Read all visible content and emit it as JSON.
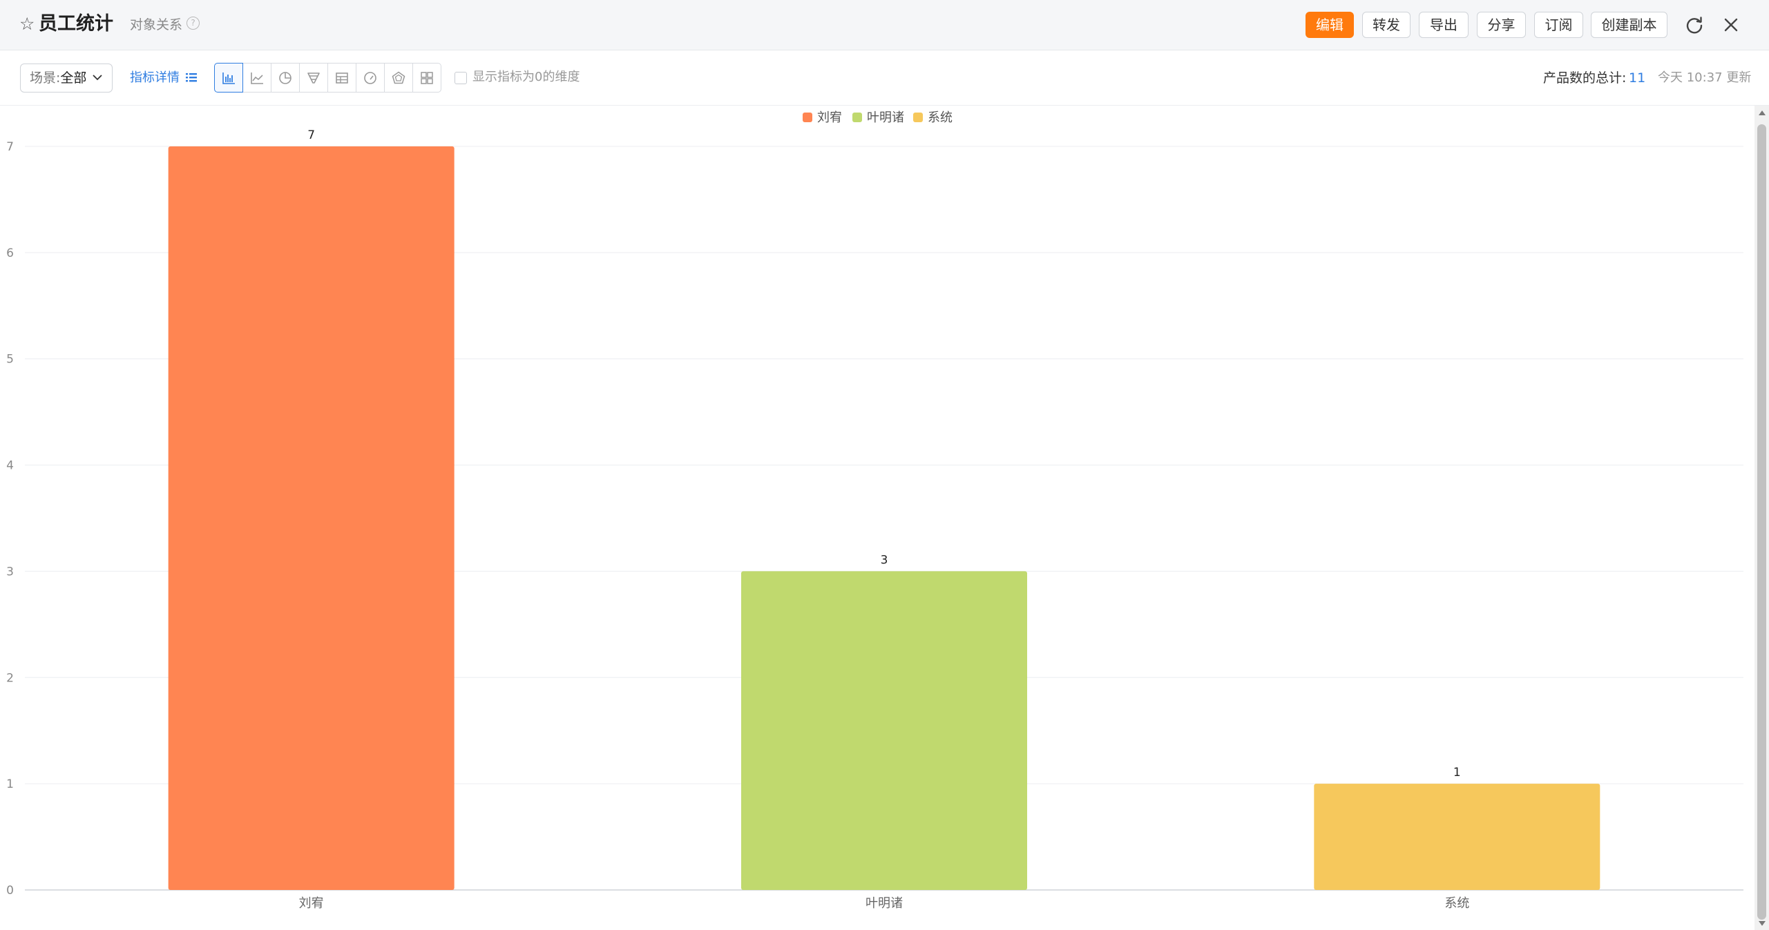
{
  "header": {
    "title": "员工统计",
    "subtitle": "对象关系",
    "buttons": {
      "edit": "编辑",
      "forward": "转发",
      "export": "导出",
      "share": "分享",
      "subscribe": "订阅",
      "copy": "创建副本"
    },
    "icons": [
      "star-icon",
      "help-icon",
      "refresh-icon",
      "close-icon"
    ]
  },
  "toolbar": {
    "scene_label": "场景:",
    "scene_value": "全部",
    "metric_detail_link": "指标详情",
    "chart_types": [
      "bar",
      "line",
      "pie",
      "funnel",
      "table",
      "gauge",
      "radar",
      "grid"
    ],
    "active_chart_type": "bar",
    "zero_checkbox_label": "显示指标为0的维度",
    "zero_checkbox_checked": false,
    "total_label": "产品数的总计:",
    "total_value": "11",
    "updated_text": "今天 10:37 更新"
  },
  "colors": {
    "accent": "#ff7a0d",
    "link": "#2f7de1"
  },
  "chart_data": {
    "type": "bar",
    "categories": [
      "刘宥",
      "叶明诸",
      "系统"
    ],
    "values": [
      7,
      3,
      1
    ],
    "colors": [
      "#ff8552",
      "#c0d96e",
      "#f6c85c"
    ],
    "legend": [
      "刘宥",
      "叶明诸",
      "系统"
    ],
    "legend_position": "top-center",
    "ylim": [
      0,
      7
    ],
    "yticks": [
      0,
      1,
      2,
      3,
      4,
      5,
      6,
      7
    ],
    "grid": true,
    "data_labels": true
  }
}
